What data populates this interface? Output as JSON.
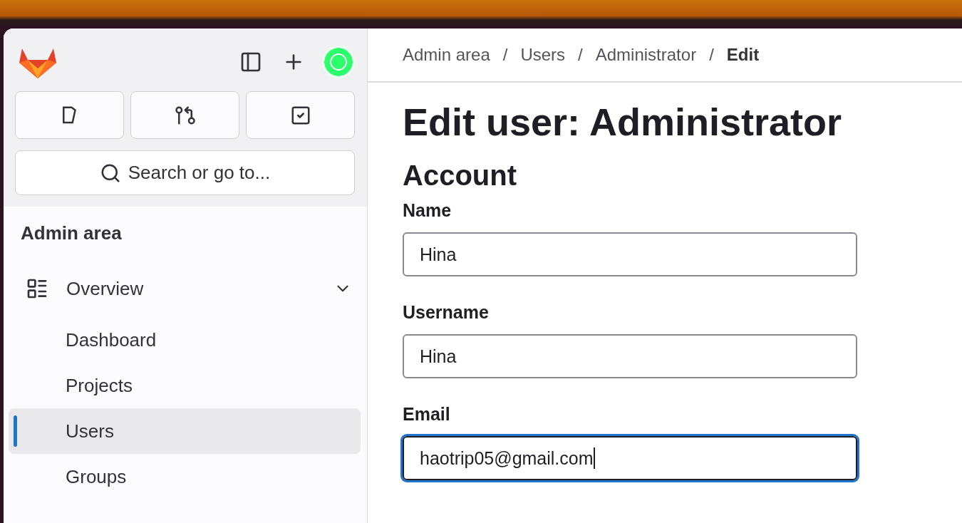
{
  "sidebar": {
    "actions": [
      {
        "kind": "panel"
      },
      {
        "kind": "plus"
      }
    ],
    "shortcuts": [
      {
        "kind": "issues"
      },
      {
        "kind": "merge"
      },
      {
        "kind": "todo"
      }
    ],
    "search": {
      "placeholder": "Search or go to..."
    },
    "section_title": "Admin area",
    "groups": [
      {
        "label": "Overview",
        "expanded": true,
        "children": [
          {
            "label": "Dashboard",
            "selected": false
          },
          {
            "label": "Projects",
            "selected": false
          },
          {
            "label": "Users",
            "selected": true
          },
          {
            "label": "Groups",
            "selected": false
          }
        ]
      }
    ]
  },
  "breadcrumbs": [
    {
      "kind": "link",
      "text": "Admin area"
    },
    {
      "kind": "separator",
      "text": "/"
    },
    {
      "kind": "link",
      "text": "Users"
    },
    {
      "kind": "separator",
      "text": "/"
    },
    {
      "kind": "link",
      "text": "Administrator"
    },
    {
      "kind": "separator",
      "text": "/"
    },
    {
      "kind": "current",
      "text": "Edit"
    }
  ],
  "page_title": "Edit user: Administrator",
  "section": "Account",
  "fields": [
    {
      "label": "Name",
      "value": "Hina",
      "focused": false
    },
    {
      "label": "Username",
      "value": "Hina",
      "focused": false
    },
    {
      "label": "Email",
      "value": "haotrip05@gmail.com",
      "focused": true
    }
  ]
}
